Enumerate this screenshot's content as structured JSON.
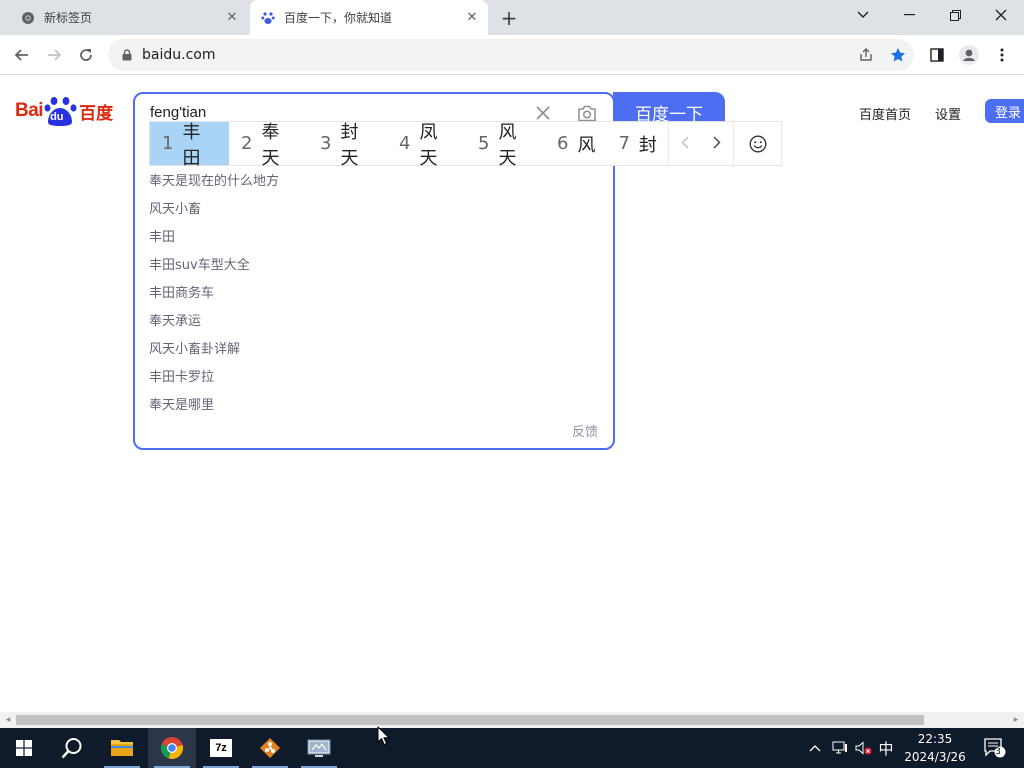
{
  "browser": {
    "tabs": [
      {
        "title": "新标签页",
        "active": false
      },
      {
        "title": "百度一下，你就知道",
        "active": true
      }
    ],
    "url": "baidu.com"
  },
  "baidu": {
    "logo": {
      "bai": "Bai",
      "du": "du",
      "cn": "百度"
    },
    "query": "feng'tian",
    "search_button": "百度一下",
    "suggestions": [
      "奉天是现在的什么地方",
      "风天小畜",
      "丰田",
      "丰田suv车型大全",
      "丰田商务车",
      "奉天承运",
      "风天小畜卦详解",
      "丰田卡罗拉",
      "奉天是哪里"
    ],
    "feedback": "反馈",
    "top_links": {
      "home": "百度首页",
      "settings": "设置",
      "login": "登录"
    }
  },
  "ime": {
    "candidates": [
      {
        "num": "1",
        "text": "丰田"
      },
      {
        "num": "2",
        "text": "奉天"
      },
      {
        "num": "3",
        "text": "封天"
      },
      {
        "num": "4",
        "text": "凤天"
      },
      {
        "num": "5",
        "text": "风天"
      },
      {
        "num": "6",
        "text": "风"
      },
      {
        "num": "7",
        "text": "封"
      }
    ],
    "selected_index": 0
  },
  "taskbar": {
    "apps": [
      "start-icon",
      "search-icon",
      "file-explorer-icon",
      "chrome-icon",
      "7zip-icon",
      "git-icon",
      "network-icon"
    ],
    "seven_zip_label": "7z",
    "ime_indicator": "中",
    "time": "22:35",
    "date": "2024/3/26",
    "notification_count": "3"
  },
  "colors": {
    "accent": "#4e6ef2",
    "baidu_red": "#de2910",
    "ime_selected": "#aad4f6"
  }
}
